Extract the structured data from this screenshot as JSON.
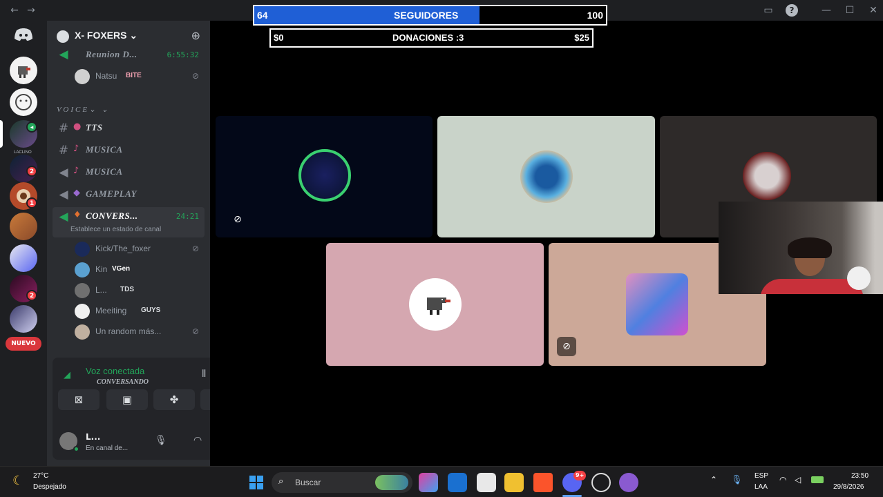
{
  "progress": {
    "followers": {
      "current": "64",
      "label": "SEGUIDORES",
      "goal": "100",
      "fraction": 0.64
    },
    "donations": {
      "current": "$0",
      "label": "DONACIONES :3",
      "goal": "$25",
      "fraction": 0
    }
  },
  "server": {
    "name": "X- FOXERS",
    "chevron": "⌄"
  },
  "voice_category": "VOICE⌄ ⌄",
  "top_event": {
    "name": "Reunion D...",
    "time": "6:55:32"
  },
  "top_user": {
    "name": "Natsu",
    "tag": "BITE"
  },
  "channels": [
    {
      "icon": "text",
      "emoji": "",
      "name": "TTS"
    },
    {
      "icon": "text",
      "emoji": "",
      "name": "MUSICA"
    },
    {
      "icon": "voice",
      "emoji": "",
      "name": "MUSICA"
    },
    {
      "icon": "voice",
      "emoji": "",
      "name": "GAMEPLAY"
    }
  ],
  "active_channel": {
    "name": "CONVERS...",
    "time": "24:21",
    "status": "Establece un estado de canal"
  },
  "members": [
    {
      "name": "Kick/The_foxer",
      "tag": ""
    },
    {
      "name": "Kin",
      "tag": "VGen"
    },
    {
      "name": "L...",
      "tag": "TDS"
    },
    {
      "name": "Meeiting",
      "tag": "GUYS"
    },
    {
      "name": "Un random más...",
      "tag": ""
    }
  ],
  "rail": {
    "nuevo": "NUEVO",
    "badges": [
      "2",
      "1",
      "2"
    ],
    "small_label": "LACLINO"
  },
  "voice_panel": {
    "title": "Voz conectada",
    "channel": "CONVERSANDO"
  },
  "user_panel": {
    "name": "L...",
    "status": "En canal de..."
  },
  "taskbar": {
    "weather_temp": "27°C",
    "weather_desc": "Despejado",
    "search_placeholder": "Buscar",
    "lang_top": "ESP",
    "lang_bottom": "LAA",
    "time": "23:50",
    "date": "29/8/2026",
    "discord_badge": "9+"
  },
  "colors": {
    "accent_blue": "#1f5fd6",
    "discord_bg": "#2b2d31",
    "online_green": "#23a55a",
    "danger": "#da373c"
  }
}
